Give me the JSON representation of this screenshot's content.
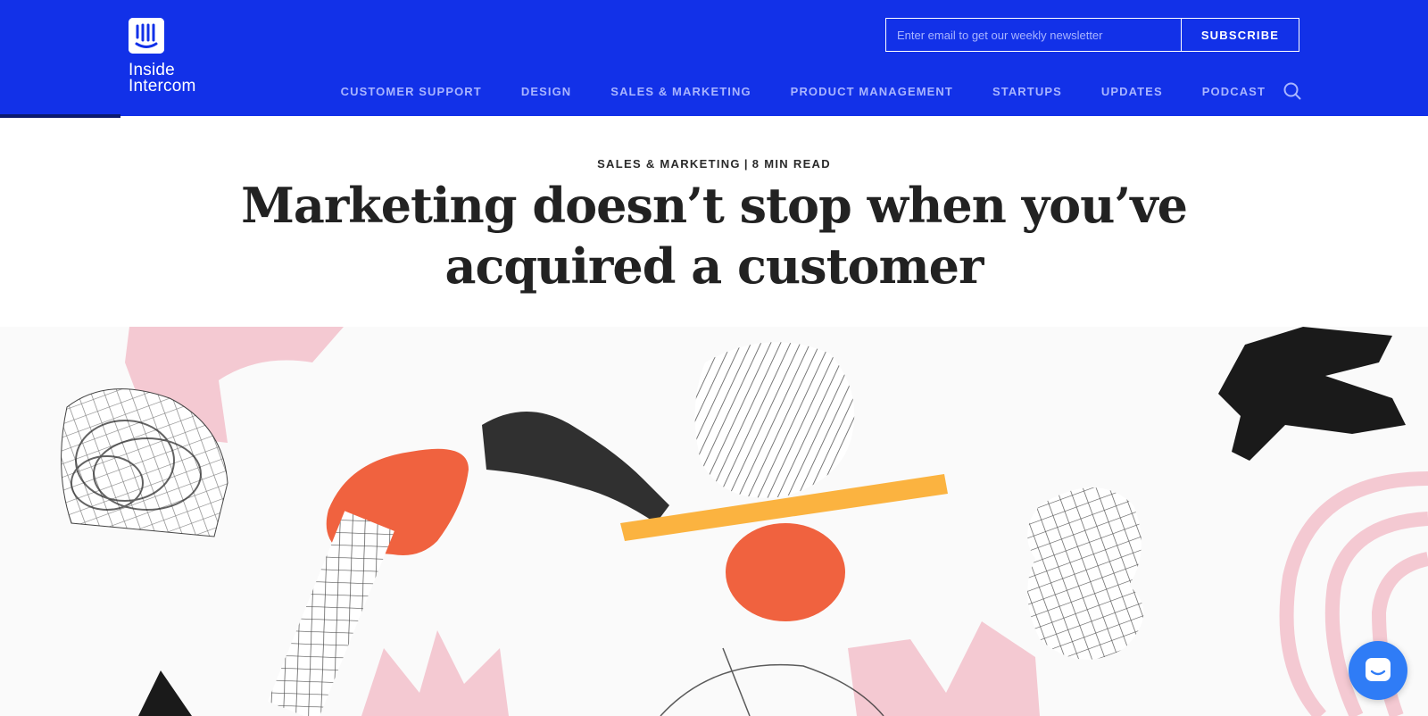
{
  "brand": {
    "line1": "Inside",
    "line2": "Intercom",
    "logo_icon": "intercom-logo-icon"
  },
  "newsletter": {
    "placeholder": "Enter email to get our weekly newsletter",
    "value": "",
    "button_label": "SUBSCRIBE"
  },
  "nav": {
    "items": [
      {
        "label": "CUSTOMER SUPPORT"
      },
      {
        "label": "DESIGN"
      },
      {
        "label": "SALES & MARKETING"
      },
      {
        "label": "PRODUCT MANAGEMENT"
      },
      {
        "label": "STARTUPS"
      },
      {
        "label": "UPDATES"
      },
      {
        "label": "PODCAST"
      }
    ],
    "search_icon": "search-icon"
  },
  "article": {
    "category": "SALES & MARKETING",
    "separator": "|",
    "read_time": "8 MIN READ",
    "title": "Marketing doesn’t stop when you’ve acquired a customer"
  },
  "chat": {
    "icon": "chat-bubble-icon"
  },
  "colors": {
    "header_bg": "#1231e8",
    "nav_text": "#a9b5ff",
    "accent_red": "#f0623f",
    "accent_yellow": "#fbb340",
    "accent_pink": "#f4c9d2",
    "launcher_blue": "#2f7cf6"
  }
}
